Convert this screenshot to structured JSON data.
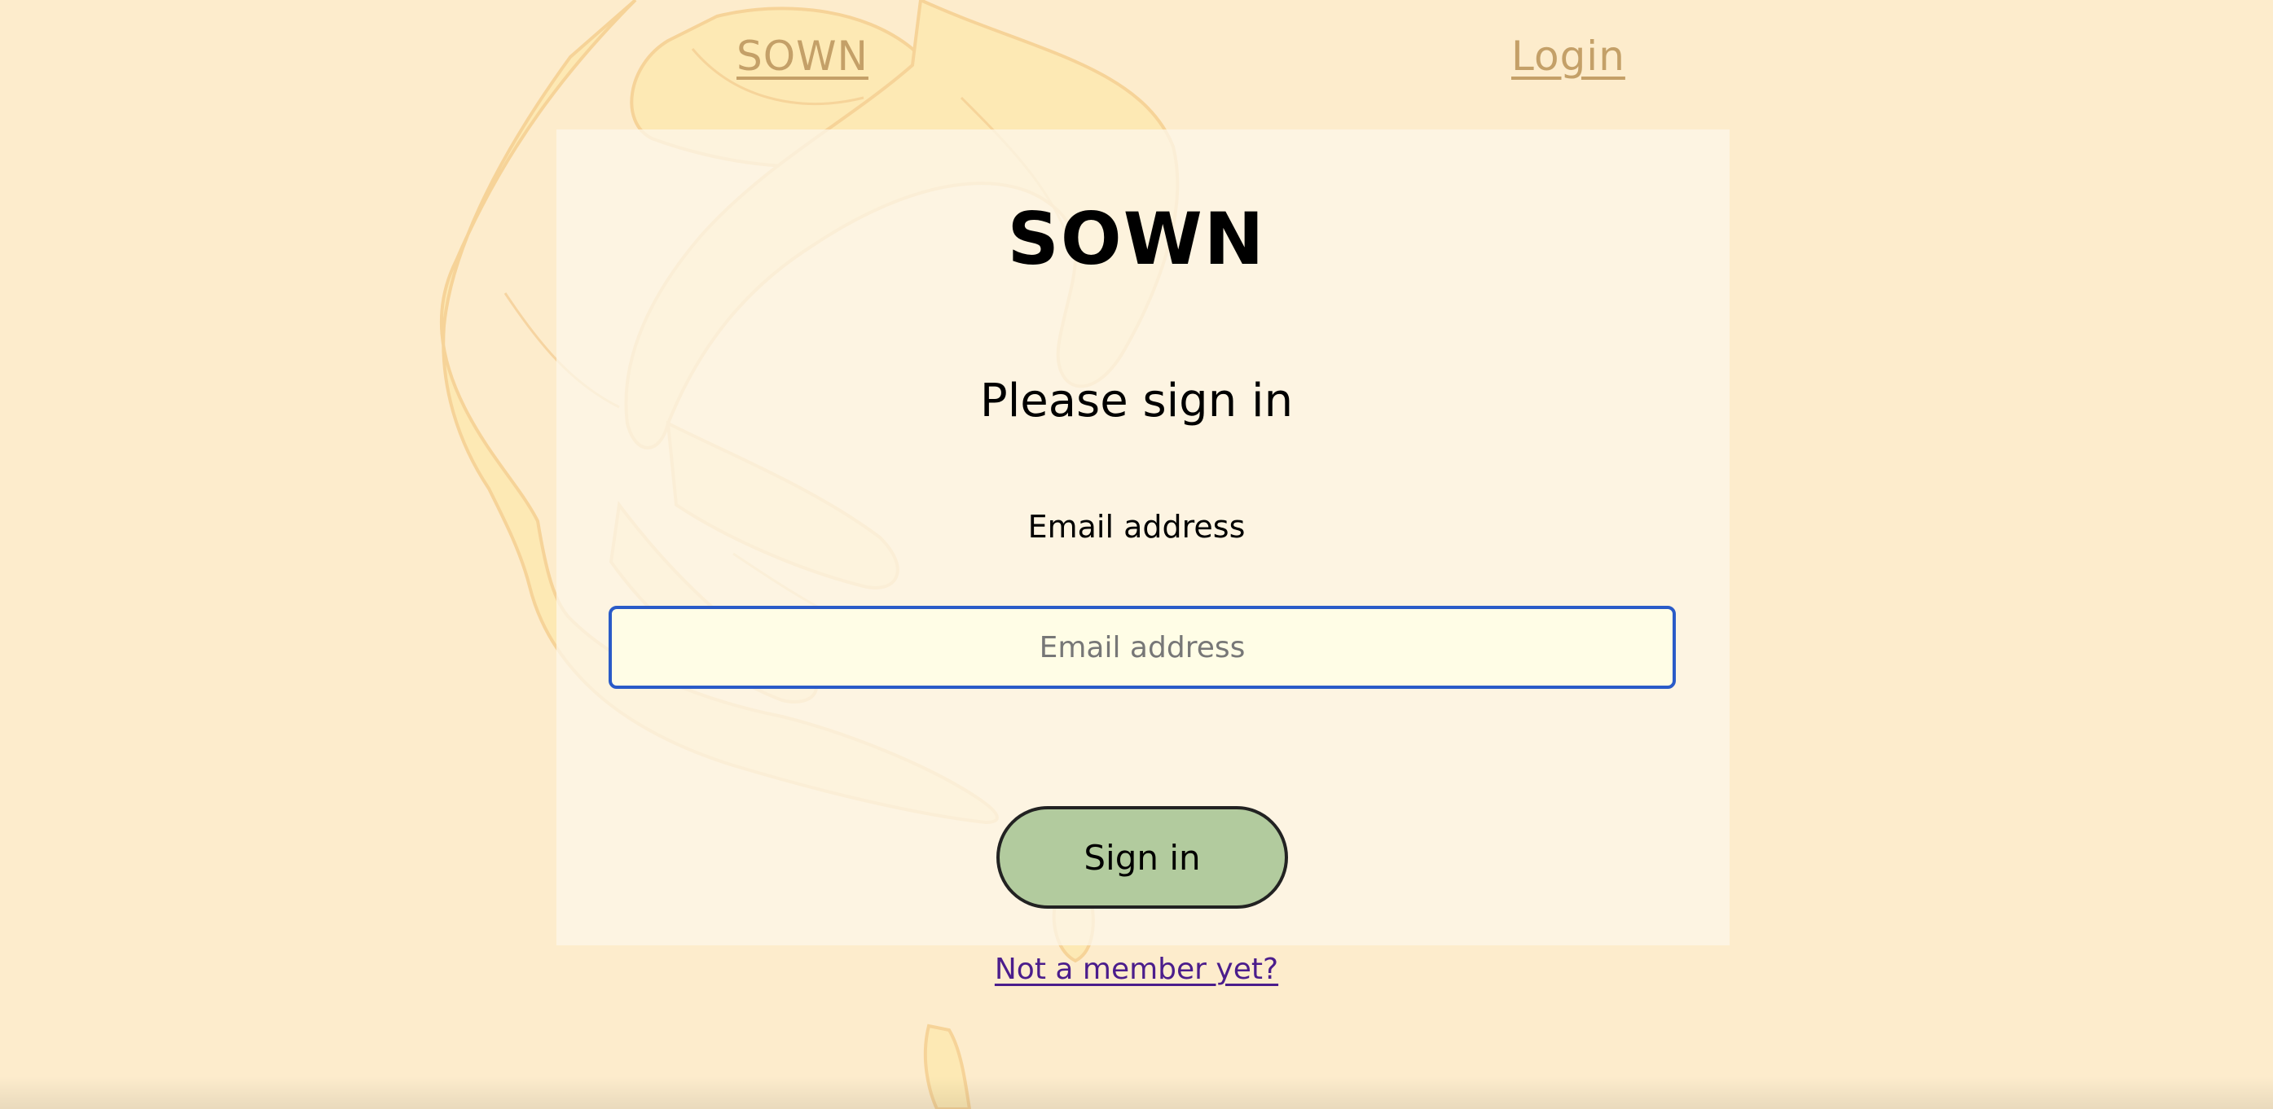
{
  "nav": {
    "brand": "SOWN",
    "login": "Login"
  },
  "card": {
    "title": "SOWN",
    "subtitle": "Please sign in",
    "email_label": "Email address",
    "email_placeholder": "Email address",
    "email_value": "",
    "sign_in_label": "Sign in"
  },
  "footer": {
    "signup_link": "Not a member yet?"
  },
  "colors": {
    "background": "#fdeccc",
    "nav_link": "#c4a068",
    "input_border": "#2a5bc8",
    "button": "#b2cb9e",
    "signup_link": "#4b1d8c"
  },
  "icons": {
    "background": "hand-illustration"
  }
}
